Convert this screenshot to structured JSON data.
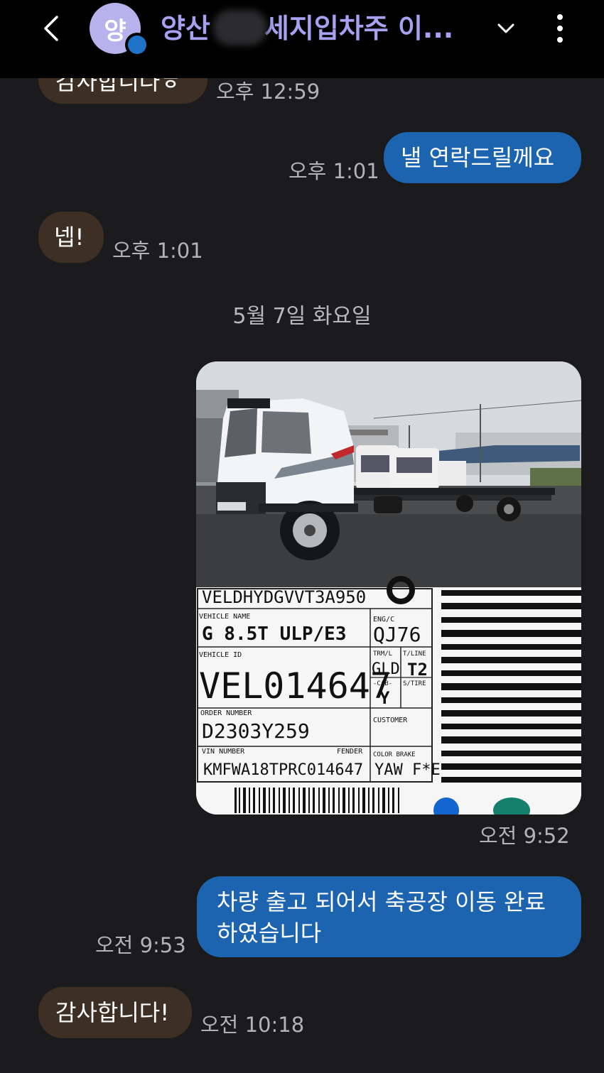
{
  "header": {
    "avatar_letter": "양",
    "title": "양산　　세지입차주 이...",
    "accent_color": "#a6a2f1"
  },
  "messages": [
    {
      "text": "감사합니다ㅎ",
      "time": "오후 12:59"
    },
    {
      "text": "낼 연락드릴께요",
      "time": "오후 1:01"
    },
    {
      "text": "넵!",
      "time": "오후 1:01"
    },
    {
      "date": "5월 7일 화요일"
    },
    {
      "photo_time": "오전 9:52",
      "label": {
        "top_code": "VELDHYDGVVT3A950",
        "vehicle_name_label": "VEHICLE NAME",
        "vehicle_name": "G 8.5T ULP/E3",
        "eng_label": "ENG/C",
        "eng": "QJ76",
        "vehicle_id_label": "VEHICLE ID",
        "vehicle_id": "VEL014647",
        "trm_label": "TRM/L",
        "trm": "GLD",
        "tline_label": "T/LINE",
        "tline": "T2",
        "cab_label": "-CAB-",
        "cab": "Y",
        "stire_label": "S/TIRE",
        "order_label": "ORDER NUMBER",
        "order": "D2303Y259",
        "customer_label": "CUSTOMER",
        "vin_label": "VIN NUMBER",
        "fender_label": "FENDER",
        "vin": "KMFWA18TPRC014647",
        "color_label": "COLOR BRAKE",
        "color": "YAW F*E"
      }
    },
    {
      "text_line1": "차량 출고 되어서 축공장 이동 완료",
      "text_line2": "하였습니다",
      "time": "오전 9:53"
    },
    {
      "text": "감사합니다!",
      "time": "오전 10:18"
    }
  ],
  "colors": {
    "incoming": "#3d2f24",
    "outgoing": "#1c64b0",
    "background": "#1b1b1d"
  }
}
